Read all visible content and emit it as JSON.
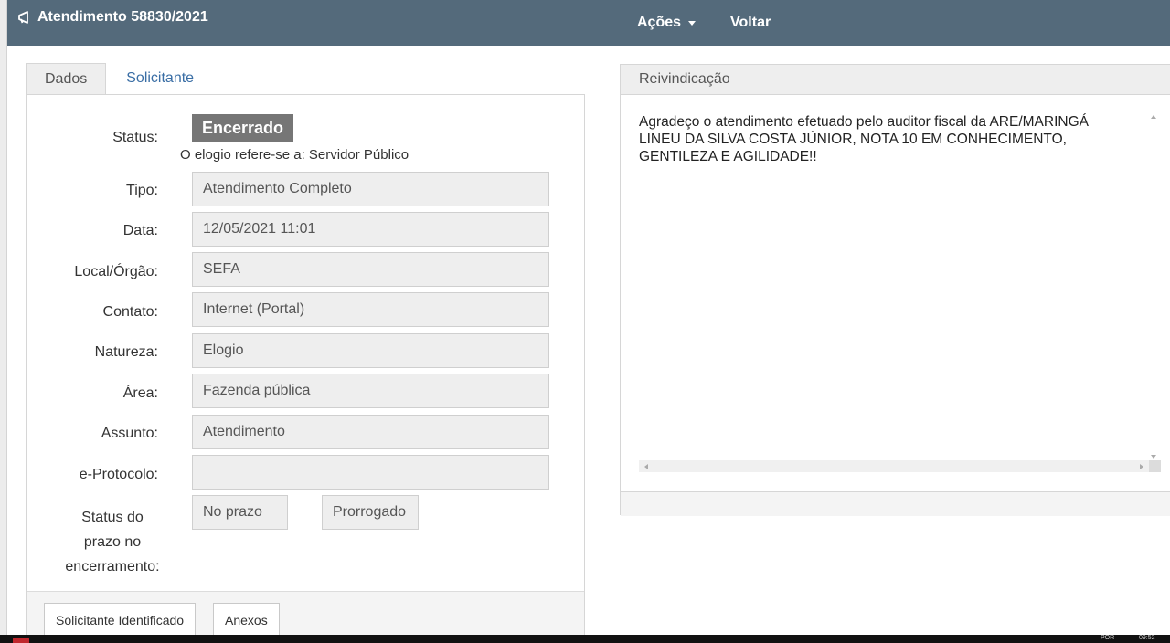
{
  "header": {
    "title": "Atendimento 58830/2021",
    "icon": "megaphone-icon",
    "nav": {
      "acoes": "Ações",
      "voltar": "Voltar"
    }
  },
  "tabs": [
    {
      "label": "Dados",
      "active": true
    },
    {
      "label": "Solicitante",
      "active": false
    }
  ],
  "details": {
    "status_label": "Status:",
    "status_value": "Encerrado",
    "praise_note": "O elogio refere-se a: Servidor Público",
    "fields": [
      {
        "label": "Tipo:",
        "value": "Atendimento Completo"
      },
      {
        "label": "Data:",
        "value": "12/05/2021 11:01"
      },
      {
        "label": "Local/Órgão:",
        "value": "SEFA"
      },
      {
        "label": "Contato:",
        "value": "Internet (Portal)"
      },
      {
        "label": "Natureza:",
        "value": "Elogio"
      },
      {
        "label": "Área:",
        "value": "Fazenda pública"
      },
      {
        "label": "Assunto:",
        "value": "Atendimento"
      },
      {
        "label": "e-Protocolo:",
        "value": ""
      }
    ],
    "deadline": {
      "label_line1": "Status do",
      "label_line2": "prazo no",
      "label_line3": "encerramento:",
      "value1": "No prazo",
      "value2": "Prorrogado"
    }
  },
  "bottom_buttons": {
    "solicitante": "Solicitante Identificado",
    "anexos": "Anexos"
  },
  "reivindicacao": {
    "heading": "Reivindicação",
    "text": "Agradeço o atendimento efetuado pelo auditor fiscal da ARE/MARINGÁ LINEU DA SILVA COSTA JÚNIOR, NOTA 10 EM CONHECIMENTO, GENTILEZA E AGILIDADE!!"
  },
  "taskbar": {
    "lang": "POR",
    "time": "09:52"
  },
  "colors": {
    "topbar": "#546a7b",
    "badge": "#767676",
    "link": "#3a6ea5"
  }
}
